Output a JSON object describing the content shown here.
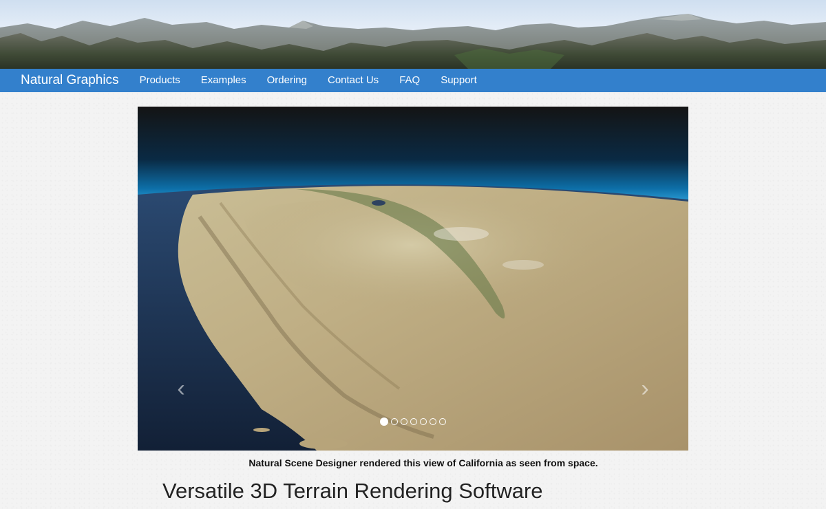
{
  "nav": {
    "brand": "Natural Graphics",
    "items": [
      {
        "label": "Products"
      },
      {
        "label": "Examples"
      },
      {
        "label": "Ordering"
      },
      {
        "label": "Contact Us"
      },
      {
        "label": "FAQ"
      },
      {
        "label": "Support"
      }
    ]
  },
  "carousel": {
    "prev_icon": "chevron-left-icon",
    "next_icon": "chevron-right-icon",
    "slide_count": 7,
    "active_slide": 1,
    "caption": "Natural Scene Designer rendered this view of California as seen from space."
  },
  "main": {
    "headline": "Versatile 3D Terrain Rendering Software"
  },
  "colors": {
    "nav_background": "#3380cc",
    "nav_text": "#ffffff"
  }
}
